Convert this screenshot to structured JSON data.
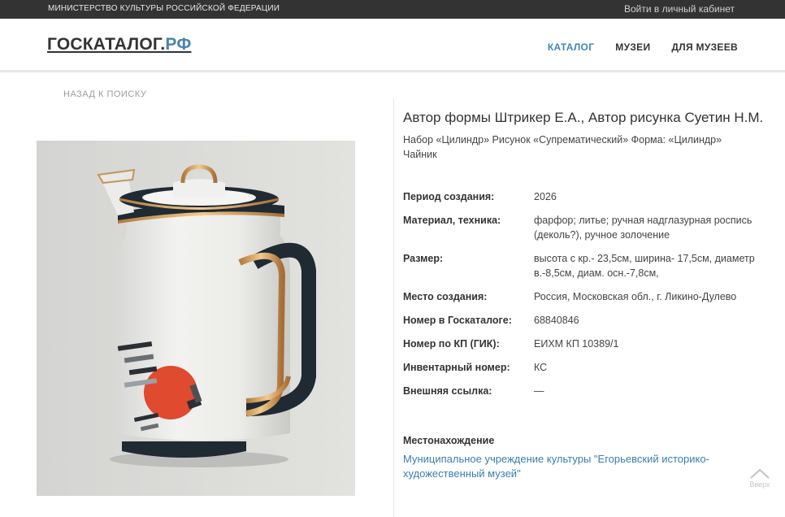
{
  "topbar": {
    "ministry": "МИНИСТЕРСТВО КУЛЬТУРЫ РОССИЙСКОЙ ФЕДЕРАЦИИ",
    "login": "Войти в личный кабинет"
  },
  "header": {
    "logo_main": "ГОСКАТАЛОГ.",
    "logo_suffix": "РФ",
    "nav": [
      {
        "label": "КАТАЛОГ",
        "active": true
      },
      {
        "label": "МУЗЕИ",
        "active": false
      },
      {
        "label": "ДЛЯ МУЗЕЕВ",
        "active": false
      }
    ]
  },
  "back_link": "НАЗАД К ПОИСКУ",
  "item": {
    "title": "Автор формы Штрикер Е.А., Автор рисунка Суетин Н.М.",
    "subtitle": "Набор «Цилиндр» Рисунок «Супрематический» Форма: «Цилиндр» Чайник",
    "properties": [
      {
        "key": "Период создания:",
        "value": "2026"
      },
      {
        "key": "Материал, техника:",
        "value": "фарфор; литье; ручная надглазурная роспись (деколь?), ручное золочение"
      },
      {
        "key": "Размер:",
        "value": "высота с кр.- 23,5см, ширина- 17,5см, диаметр в.-8,5см, диам. осн.-7,8см,"
      },
      {
        "key": "Место создания:",
        "value": "Россия, Московская обл., г. Ликино-Дулево"
      },
      {
        "key": "Номер в Госкаталоге:",
        "value": "68840846"
      },
      {
        "key": "Номер по КП (ГИК):",
        "value": "ЕИХМ КП 10389/1"
      },
      {
        "key": "Инвентарный номер:",
        "value": "КС"
      },
      {
        "key": "Внешняя ссылка:",
        "value": "—"
      }
    ],
    "location_label": "Местонахождение",
    "location_link": "Муниципальное учреждение культуры \"Егорьевский историко-художественный музей\""
  },
  "to_top": {
    "label": "Вверх",
    "icon": "chevron-up-icon"
  },
  "colors": {
    "topbar_bg": "#333333",
    "accent_blue": "#3f86b8",
    "link_blue": "#3a7db0"
  }
}
